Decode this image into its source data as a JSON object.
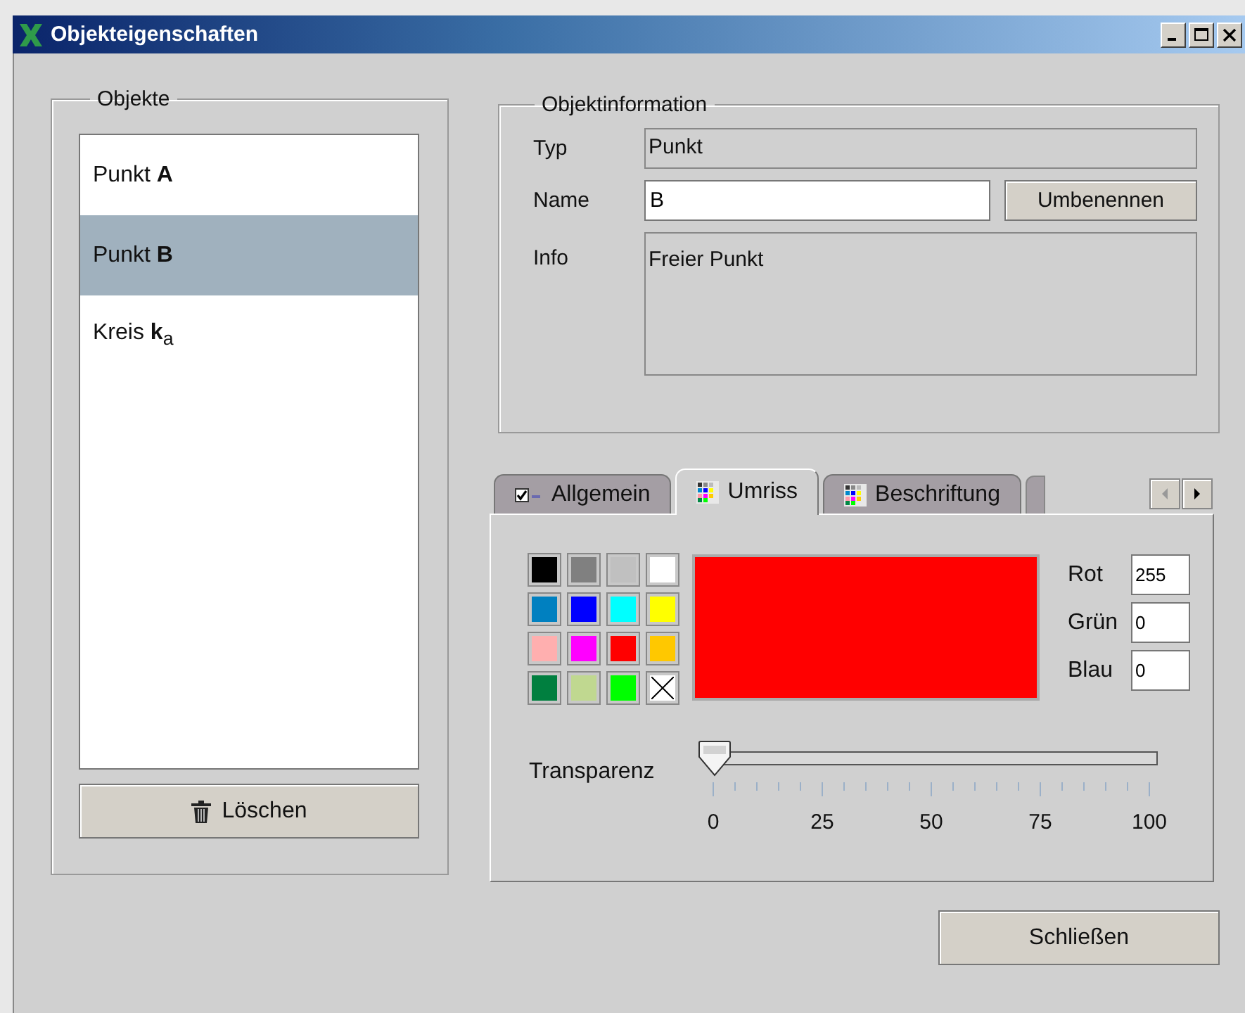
{
  "window": {
    "title": "Objekteigenschaften"
  },
  "objects": {
    "title": "Objekte",
    "items": [
      {
        "label": "Punkt **A**",
        "selected": false
      },
      {
        "label": "Punkt **B**",
        "selected": true
      },
      {
        "label": "Kreis **k**$_{a}$",
        "selected": false
      }
    ],
    "delete_button": "Löschen"
  },
  "object_info": {
    "title": "Objektinformation",
    "type_label": "Typ",
    "type_value": "Punkt",
    "name_label": "Name",
    "name_value": "B",
    "rename_button": "Umbenennen",
    "info_label": "Info",
    "info_value": "Freier Punkt"
  },
  "tabs": [
    {
      "label": "Allgemein",
      "selected": false,
      "kind": "check"
    },
    {
      "label": "Umriss",
      "selected": true,
      "kind": "palette"
    },
    {
      "label": "Beschriftung",
      "selected": false,
      "kind": "palette"
    }
  ],
  "tab_scroll": {
    "left_disabled": true,
    "right_disabled": false
  },
  "swatches": [
    {
      "kind": "color",
      "color": "#000000"
    },
    {
      "kind": "color",
      "color": "#808080"
    },
    {
      "kind": "color",
      "color": "#c0c0c0"
    },
    {
      "kind": "color",
      "color": "#ffffff"
    },
    {
      "kind": "color",
      "color": "#0080c0"
    },
    {
      "kind": "color",
      "color": "#0000ff"
    },
    {
      "kind": "color",
      "color": "#00ffff"
    },
    {
      "kind": "color",
      "color": "#ffff00"
    },
    {
      "kind": "color",
      "color": "#ffafaf"
    },
    {
      "kind": "color",
      "color": "#ff00ff"
    },
    {
      "kind": "color",
      "color": "#ff0000"
    },
    {
      "kind": "color",
      "color": "#ffc800"
    },
    {
      "kind": "color",
      "color": "#007f3f"
    },
    {
      "kind": "color",
      "color": "#c0d890"
    },
    {
      "kind": "color",
      "color": "#00ff00"
    },
    {
      "kind": "none"
    }
  ],
  "preview": {
    "color": "#ff0000"
  },
  "rgb": [
    {
      "label": "Rot",
      "value": "255"
    },
    {
      "label": "Grün",
      "value": "0"
    },
    {
      "label": "Blau",
      "value": "0"
    }
  ],
  "transparency": {
    "label": "Transparenz",
    "level": 0,
    "tick_labels": [
      "0",
      "25",
      "50",
      "75",
      "100"
    ]
  },
  "close_button": "Schließen"
}
